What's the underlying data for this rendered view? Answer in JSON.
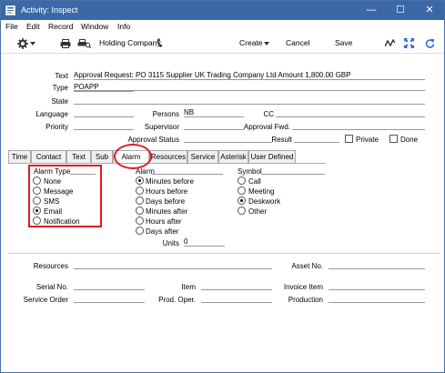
{
  "window": {
    "title": "Activity: Inspect",
    "minimize": "—",
    "maximize": "☐",
    "close": "✕"
  },
  "menu": [
    "File",
    "Edit",
    "Record",
    "Window",
    "Info"
  ],
  "toolbar": {
    "company": "Holding Company",
    "create": "Create",
    "cancel": "Cancel",
    "save": "Save"
  },
  "form": {
    "text_label": "Text",
    "text_value": "Approval Request: PO 3115 Supplier UK Trading Company Ltd Amount 1,800.00 GBP",
    "type_label": "Type",
    "type_value": "POAPP",
    "state_label": "State",
    "state_value": "",
    "language_label": "Language",
    "language_value": "",
    "persons_label": "Persons",
    "persons_value": "NB",
    "cc_label": "CC",
    "cc_value": "",
    "priority_label": "Priority",
    "priority_value": "",
    "supervisor_label": "Supervisor",
    "supervisor_value": "",
    "approval_fwd_label": "Approval Fwd.",
    "approval_fwd_value": "",
    "approval_status_label": "Approval Status",
    "approval_status_value": "",
    "result_label": "Result",
    "result_value": "",
    "private_label": "Private",
    "done_label": "Done"
  },
  "tabs": [
    "Time",
    "Contact",
    "Text",
    "Sub",
    "Alarm",
    "Resources",
    "Service",
    "Asterisk",
    "User Defined"
  ],
  "active_tab": "Alarm",
  "alarm_type": {
    "header": "Alarm Type",
    "options": [
      "None",
      "Message",
      "SMS",
      "Email",
      "Notification"
    ],
    "selected": "Email"
  },
  "alarm": {
    "header": "Alarm",
    "options": [
      "Minutes before",
      "Hours before",
      "Days before",
      "Minutes after",
      "Hours after",
      "Days after"
    ],
    "selected": "Minutes before",
    "units_label": "Units",
    "units_value": "0"
  },
  "symbol": {
    "header": "Symbol",
    "options": [
      "Call",
      "Meeting",
      "Deskwork",
      "Other"
    ],
    "selected": "Deskwork"
  },
  "footer": {
    "resources_label": "Resources",
    "resources_value": "",
    "asset_label": "Asset No.",
    "asset_value": "",
    "serial_label": "Serial No.",
    "serial_value": "",
    "item_label": "Item",
    "item_value": "",
    "invoice_item_label": "Invoice Item",
    "invoice_item_value": "",
    "service_order_label": "Service Order",
    "service_order_value": "",
    "prod_oper_label": "Prod. Oper.",
    "prod_oper_value": "",
    "production_label": "Production",
    "production_value": ""
  }
}
